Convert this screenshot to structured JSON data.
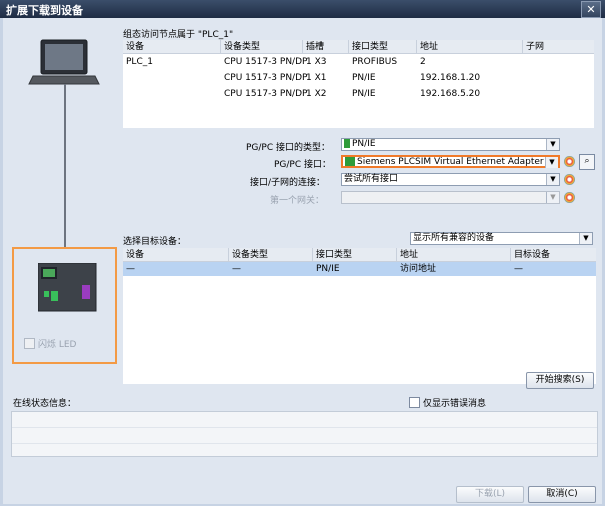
{
  "window": {
    "title": "扩展下载到设备",
    "close_glyph": "✕"
  },
  "access_table": {
    "caption": "组态访问节点属于 \"PLC_1\"",
    "columns": [
      "设备",
      "设备类型",
      "插槽",
      "接口类型",
      "地址",
      "子网"
    ],
    "rows": [
      [
        "PLC_1",
        "CPU 1517-3 PN/DP",
        "1 X3",
        "PROFIBUS",
        "2",
        ""
      ],
      [
        "",
        "CPU 1517-3 PN/DP",
        "1 X1",
        "PN/IE",
        "192.168.1.20",
        ""
      ],
      [
        "",
        "CPU 1517-3 PN/DP",
        "1 X2",
        "PN/IE",
        "192.168.5.20",
        ""
      ]
    ]
  },
  "settings": {
    "pgpc_type_label": "PG/PC 接口的类型：",
    "pgpc_type_value": "PN/IE",
    "pgpc_if_label": "PG/PC 接口：",
    "pgpc_if_value": "Siemens PLCSIM Virtual Ethernet Adapter",
    "conn_label": "接口/子网的连接：",
    "conn_value": "尝试所有接口",
    "gateway_label": "第一个网关：",
    "gateway_value": ""
  },
  "target": {
    "label": "选择目标设备：",
    "filter_value": "显示所有兼容的设备",
    "columns": [
      "设备",
      "设备类型",
      "接口类型",
      "地址",
      "目标设备"
    ],
    "rows": [
      [
        "—",
        "—",
        "PN/IE",
        "访问地址",
        "—"
      ]
    ],
    "search_button": "开始搜索(S)"
  },
  "device_panel": {
    "flash_led_label": "闪烁 LED"
  },
  "online_status": {
    "label": "在线状态信息：",
    "errors_only_label": "仅显示错误消息"
  },
  "footer": {
    "download_button": "下载(L)",
    "cancel_button": "取消(C)"
  },
  "colors": {
    "highlight_orange": "#f07a2a",
    "selected_row": "#b9d3f2",
    "ethernet_green": "#2e9b3a"
  }
}
